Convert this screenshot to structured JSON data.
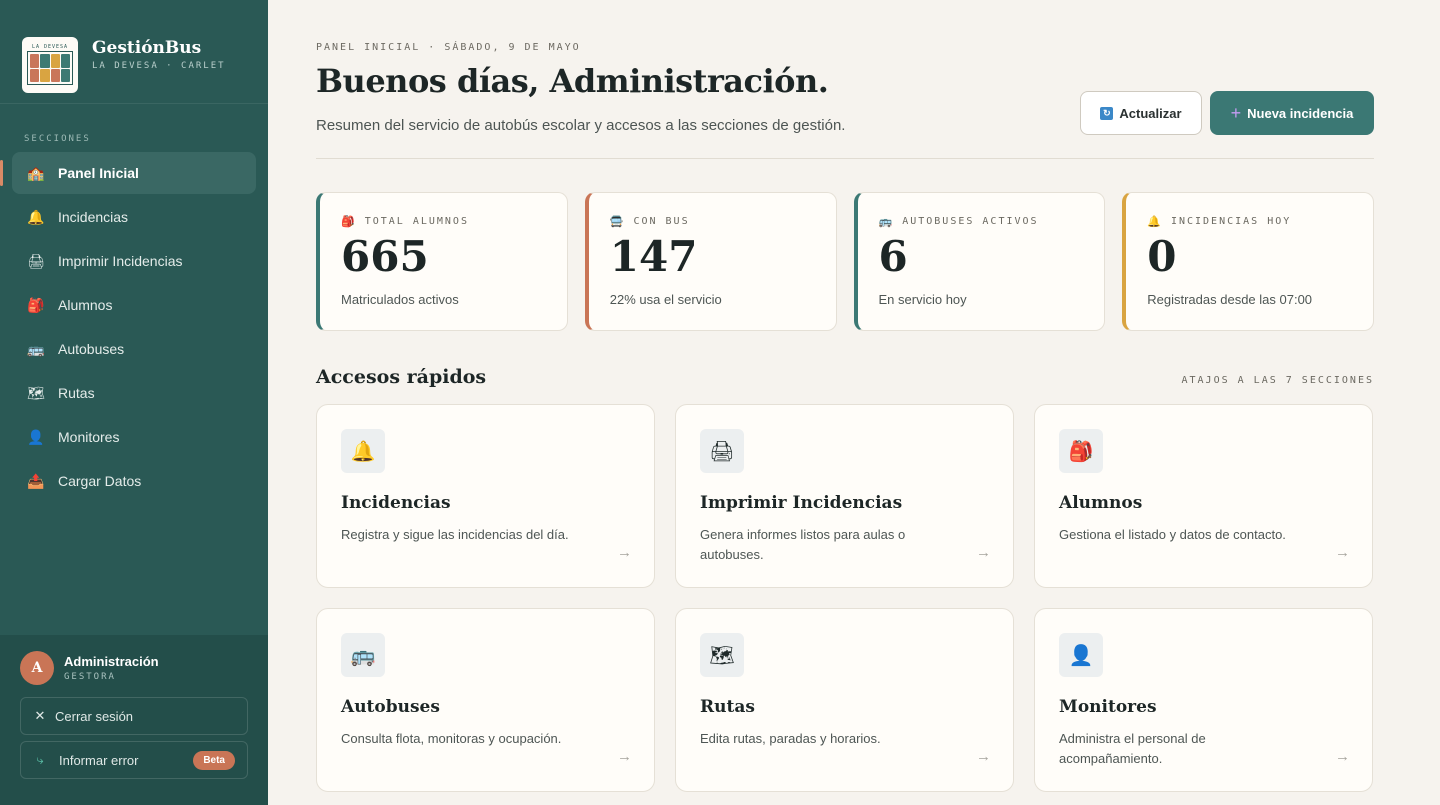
{
  "brand": {
    "title": "GestiónBus",
    "subtitle": "LA DEVESA · CARLET",
    "logo_text": "LA DEVESA"
  },
  "sidebar": {
    "section_label": "SECCIONES",
    "items": [
      {
        "label": "Panel Inicial",
        "icon": "🏫"
      },
      {
        "label": "Incidencias",
        "icon": "🔔"
      },
      {
        "label": "Imprimir Incidencias",
        "icon": "🖨"
      },
      {
        "label": "Alumnos",
        "icon": "🎒"
      },
      {
        "label": "Autobuses",
        "icon": "🚌"
      },
      {
        "label": "Rutas",
        "icon": "🗺"
      },
      {
        "label": "Monitores",
        "icon": "👤"
      },
      {
        "label": "Cargar Datos",
        "icon": "📤"
      }
    ],
    "user": {
      "initial": "A",
      "name": "Administración",
      "role": "GESTORA"
    },
    "logout_label": "Cerrar sesión",
    "report_label": "Informar error",
    "beta_label": "Beta"
  },
  "header": {
    "breadcrumb": "PANEL INICIAL · SÁBADO, 9 DE MAYO",
    "title": "Buenos días, Administración.",
    "subtitle": "Resumen del servicio de autobús escolar y accesos a las secciones de gestión.",
    "refresh_label": "Actualizar",
    "new_label": "Nueva incidencia"
  },
  "stats": [
    {
      "label": "TOTAL ALUMNOS",
      "icon": "🎒",
      "value": "665",
      "note": "Matriculados activos",
      "color": "#3b7874"
    },
    {
      "label": "CON BUS",
      "icon": "🚍",
      "value": "147",
      "note": "22% usa el servicio",
      "color": "#c97556"
    },
    {
      "label": "AUTOBUSES ACTIVOS",
      "icon": "🚌",
      "value": "6",
      "note": "En servicio hoy",
      "color": "#3b7874"
    },
    {
      "label": "INCIDENCIAS HOY",
      "icon": "🔔",
      "value": "0",
      "note": "Registradas desde las 07:00",
      "color": "#d9a441"
    }
  ],
  "quick_access": {
    "title": "Accesos rápidos",
    "subtitle": "ATAJOS A LAS 7 SECCIONES",
    "cards": [
      {
        "title": "Incidencias",
        "desc": "Registra y sigue las incidencias del día.",
        "icon": "🔔"
      },
      {
        "title": "Imprimir Incidencias",
        "desc": "Genera informes listos para aulas o autobuses.",
        "icon": "🖨"
      },
      {
        "title": "Alumnos",
        "desc": "Gestiona el listado y datos de contacto.",
        "icon": "🎒"
      },
      {
        "title": "Autobuses",
        "desc": "Consulta flota, monitoras y ocupación.",
        "icon": "🚌"
      },
      {
        "title": "Rutas",
        "desc": "Edita rutas, paradas y horarios.",
        "icon": "🗺"
      },
      {
        "title": "Monitores",
        "desc": "Administra el personal de acompañamiento.",
        "icon": "👤"
      }
    ],
    "arrow": "→"
  }
}
